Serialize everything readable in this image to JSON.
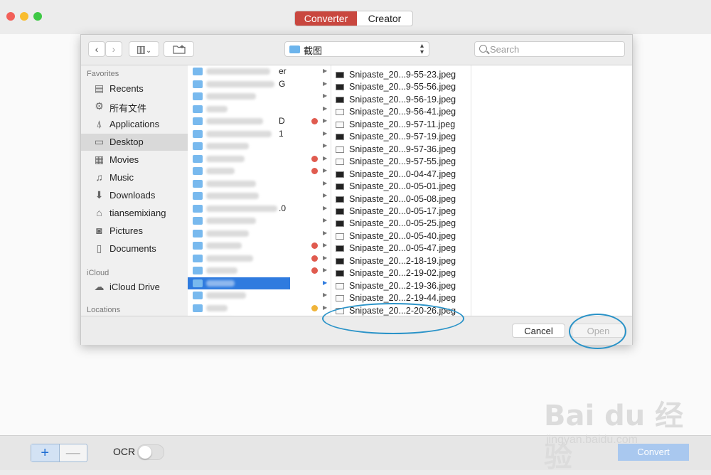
{
  "window": {
    "tabs": [
      {
        "label": "Converter",
        "active": true
      },
      {
        "label": "Creator",
        "active": false
      }
    ]
  },
  "dialog": {
    "toolbar": {
      "back": "‹",
      "forward": "›",
      "view_icon": "▥",
      "view_chevron": "⌄",
      "new_folder_icon": "folder-plus",
      "path": "截图",
      "search_placeholder": "Search"
    },
    "sidebar": {
      "sections": [
        {
          "title": "Favorites",
          "items": [
            {
              "label": "Recents",
              "icon": "recents-icon",
              "glyph": "▤"
            },
            {
              "label": "所有文件",
              "icon": "gear-icon",
              "glyph": "⚙"
            },
            {
              "label": "Applications",
              "icon": "applications-icon",
              "glyph": "⍋"
            },
            {
              "label": "Desktop",
              "icon": "desktop-icon",
              "glyph": "▭",
              "selected": true
            },
            {
              "label": "Movies",
              "icon": "movies-icon",
              "glyph": "▦"
            },
            {
              "label": "Music",
              "icon": "music-icon",
              "glyph": "♫"
            },
            {
              "label": "Downloads",
              "icon": "downloads-icon",
              "glyph": "⬇"
            },
            {
              "label": "tiansemixiang",
              "icon": "home-icon",
              "glyph": "⌂"
            },
            {
              "label": "Pictures",
              "icon": "camera-icon",
              "glyph": "◙"
            },
            {
              "label": "Documents",
              "icon": "documents-icon",
              "glyph": "▯"
            }
          ]
        },
        {
          "title": "iCloud",
          "items": [
            {
              "label": "iCloud Drive",
              "icon": "cloud-icon",
              "glyph": "☁"
            }
          ]
        },
        {
          "title": "Locations",
          "items": []
        }
      ]
    },
    "column1_visible_suffixes": [
      "er",
      "G",
      "",
      "",
      "D",
      "1",
      "",
      "",
      "",
      "",
      "",
      ".0",
      "",
      "",
      "",
      "",
      "",
      "",
      "",
      "",
      "",
      ""
    ],
    "files": [
      {
        "name": "Snipaste_20...9-55-23.jpeg",
        "thumb": "dark"
      },
      {
        "name": "Snipaste_20...9-55-56.jpeg",
        "thumb": "dark"
      },
      {
        "name": "Snipaste_20...9-56-19.jpeg",
        "thumb": "dark"
      },
      {
        "name": "Snipaste_20...9-56-41.jpeg",
        "thumb": "light"
      },
      {
        "name": "Snipaste_20...9-57-11.jpeg",
        "thumb": "light"
      },
      {
        "name": "Snipaste_20...9-57-19.jpeg",
        "thumb": "dark"
      },
      {
        "name": "Snipaste_20...9-57-36.jpeg",
        "thumb": "light"
      },
      {
        "name": "Snipaste_20...9-57-55.jpeg",
        "thumb": "light"
      },
      {
        "name": "Snipaste_20...0-04-47.jpeg",
        "thumb": "dark"
      },
      {
        "name": "Snipaste_20...0-05-01.jpeg",
        "thumb": "dark"
      },
      {
        "name": "Snipaste_20...0-05-08.jpeg",
        "thumb": "dark"
      },
      {
        "name": "Snipaste_20...0-05-17.jpeg",
        "thumb": "dark"
      },
      {
        "name": "Snipaste_20...0-05-25.jpeg",
        "thumb": "dark"
      },
      {
        "name": "Snipaste_20...0-05-40.jpeg",
        "thumb": "light"
      },
      {
        "name": "Snipaste_20...0-05-47.jpeg",
        "thumb": "dark"
      },
      {
        "name": "Snipaste_20...2-18-19.jpeg",
        "thumb": "dark"
      },
      {
        "name": "Snipaste_20...2-19-02.jpeg",
        "thumb": "dark"
      },
      {
        "name": "Snipaste_20...2-19-36.jpeg",
        "thumb": "light"
      },
      {
        "name": "Snipaste_20...2-19-44.jpeg",
        "thumb": "light"
      },
      {
        "name": "Snipaste_20...2-20-26.jpeg",
        "thumb": "light"
      }
    ],
    "buttons": {
      "cancel": "Cancel",
      "open": "Open"
    }
  },
  "bottom": {
    "add": "+",
    "remove": "—",
    "ocr_label": "OCR",
    "ocr_on": false,
    "convert": "Convert"
  },
  "watermark": {
    "main": "Bai du 经验",
    "sub": "jingyan.baidu.com"
  },
  "colors": {
    "accent": "#c9473f",
    "selection": "#2f7bdf",
    "annotation": "#2a93c8"
  }
}
